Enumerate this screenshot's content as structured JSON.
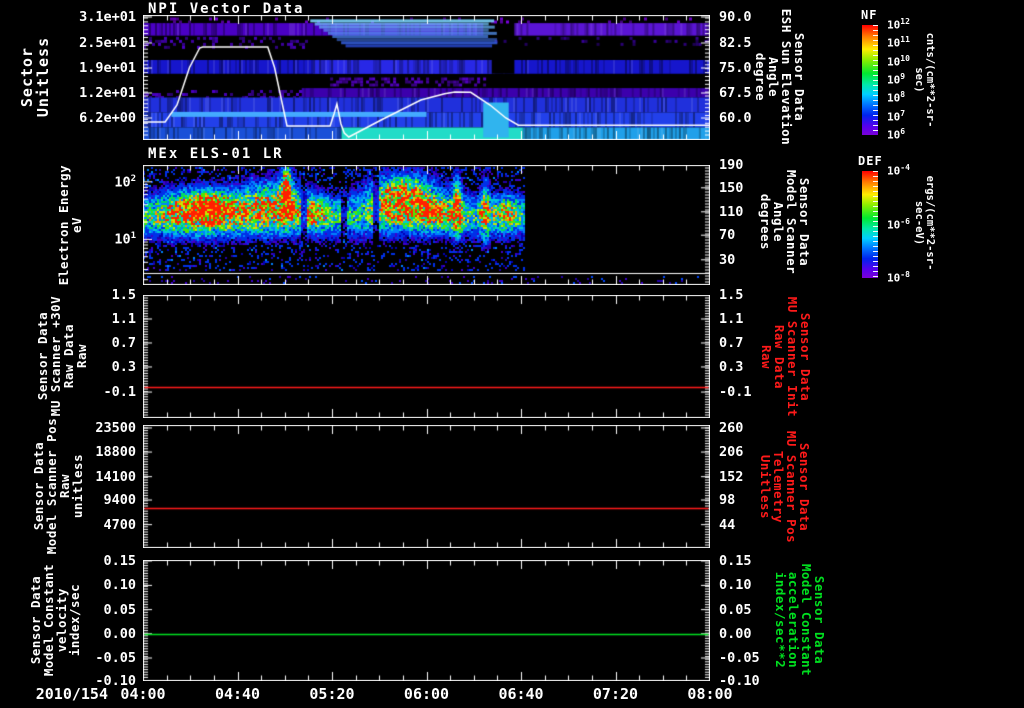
{
  "panels": [
    {
      "key": "npi",
      "title": "NPI Vector Data",
      "left_label_lines": [
        "Sector",
        "Unitless"
      ],
      "left_ticks": [
        {
          "t": "3.1e+01",
          "p": 0.016
        },
        {
          "t": "2.5e+01",
          "p": 0.224
        },
        {
          "t": "1.9e+01",
          "p": 0.424
        },
        {
          "t": "1.2e+01",
          "p": 0.624
        },
        {
          "t": "6.2e+00",
          "p": 0.824
        }
      ],
      "right_label_lines": [
        "Sensor Data",
        "ESH Sun Elevation",
        "Angle",
        "degree"
      ],
      "right_label_color": "#ffffff",
      "right_ticks": [
        {
          "t": "90.0",
          "p": 0.016
        },
        {
          "t": "82.5",
          "p": 0.224
        },
        {
          "t": "75.0",
          "p": 0.424
        },
        {
          "t": "67.5",
          "p": 0.624
        },
        {
          "t": "60.0",
          "p": 0.824
        }
      ]
    },
    {
      "key": "els",
      "title": "MEx ELS-01 LR",
      "left_label_lines": [
        "Electron Energy",
        "eV"
      ],
      "left_ticks": [
        {
          "t": "10",
          "sup": "2",
          "p": 0.14
        },
        {
          "t": "10",
          "sup": "1",
          "p": 0.62
        }
      ],
      "right_label_lines": [
        "Sensor Data",
        "Model Scanner",
        "Angle",
        "degrees"
      ],
      "right_label_color": "#ffffff",
      "right_ticks": [
        {
          "t": "190",
          "p": 0.0
        },
        {
          "t": "150",
          "p": 0.19
        },
        {
          "t": "110",
          "p": 0.39
        },
        {
          "t": "70",
          "p": 0.585
        },
        {
          "t": "30",
          "p": 0.79
        }
      ]
    },
    {
      "key": "mu-scanner-30v",
      "left_label_lines": [
        "Sensor Data",
        "MU Scanner +30V",
        "Raw Data",
        "Raw"
      ],
      "left_ticks": [
        {
          "t": "1.5",
          "p": 0.0
        },
        {
          "t": "1.1",
          "p": 0.195
        },
        {
          "t": "0.7",
          "p": 0.39
        },
        {
          "t": "0.3",
          "p": 0.585
        },
        {
          "t": "-0.1",
          "p": 0.789
        }
      ],
      "right_label_lines": [
        "Sensor Data",
        "MU Scanner Init",
        "Raw Data",
        "Raw"
      ],
      "right_label_color": "#ff1a1a",
      "right_ticks": [
        {
          "t": "1.5",
          "p": 0.0
        },
        {
          "t": "1.1",
          "p": 0.195
        },
        {
          "t": "0.7",
          "p": 0.39
        },
        {
          "t": "0.3",
          "p": 0.585
        },
        {
          "t": "-0.1",
          "p": 0.789
        }
      ],
      "hline": {
        "color": "#ff1a1a",
        "p": 0.748
      }
    },
    {
      "key": "model-scanner-pos",
      "left_label_lines": [
        "Sensor Data",
        "Model Scanner Pos",
        "Raw",
        "unitless"
      ],
      "left_ticks": [
        {
          "t": "23500",
          "p": 0.024
        },
        {
          "t": "18800",
          "p": 0.22
        },
        {
          "t": "14100",
          "p": 0.42
        },
        {
          "t": "9400",
          "p": 0.61
        },
        {
          "t": "4700",
          "p": 0.81
        }
      ],
      "right_label_lines": [
        "Sensor Data",
        "MU Scanner Pos",
        "Telemetry",
        "Unitless"
      ],
      "right_label_color": "#ff1a1a",
      "right_ticks": [
        {
          "t": "260",
          "p": 0.024
        },
        {
          "t": "206",
          "p": 0.22
        },
        {
          "t": "152",
          "p": 0.42
        },
        {
          "t": "98",
          "p": 0.61
        },
        {
          "t": "44",
          "p": 0.81
        }
      ],
      "hline": {
        "color": "#ff1a1a",
        "p": 0.675
      }
    },
    {
      "key": "model-constant",
      "left_label_lines": [
        "Sensor Data",
        "Model Constant",
        "velocity",
        "index/sec"
      ],
      "left_ticks": [
        {
          "t": "0.15",
          "p": 0.008
        },
        {
          "t": "0.10",
          "p": 0.21
        },
        {
          "t": "0.05",
          "p": 0.41
        },
        {
          "t": "0.00",
          "p": 0.61
        },
        {
          "t": "-0.05",
          "p": 0.81
        },
        {
          "t": "-0.10",
          "p": 1.0
        }
      ],
      "right_label_lines": [
        "Sensor Data",
        "Model Constant",
        "acceleration",
        "index/sec**2"
      ],
      "right_label_color": "#00e020",
      "right_ticks": [
        {
          "t": "0.15",
          "p": 0.008
        },
        {
          "t": "0.10",
          "p": 0.21
        },
        {
          "t": "0.05",
          "p": 0.41
        },
        {
          "t": "0.00",
          "p": 0.61
        },
        {
          "t": "-0.05",
          "p": 0.81
        },
        {
          "t": "-0.10",
          "p": 1.0
        }
      ],
      "hline": {
        "color": "#00e020",
        "p": 0.61
      }
    }
  ],
  "colorbars": [
    {
      "title": "NF",
      "units": "cnts/(cm**2-sr-sec)",
      "ticks": [
        {
          "t": "10",
          "sup": "12",
          "p": 0.0
        },
        {
          "t": "10",
          "sup": "11",
          "p": 0.1667
        },
        {
          "t": "10",
          "sup": "10",
          "p": 0.3333
        },
        {
          "t": "10",
          "sup": "9",
          "p": 0.5
        },
        {
          "t": "10",
          "sup": "8",
          "p": 0.6667
        },
        {
          "t": "10",
          "sup": "7",
          "p": 0.8333
        },
        {
          "t": "10",
          "sup": "6",
          "p": 1.0
        }
      ]
    },
    {
      "title": "DEF",
      "units": "ergs/(cm**2-sr-sec-eV)",
      "ticks": [
        {
          "t": "10",
          "sup": "-4",
          "p": 0.0
        },
        {
          "t": "10",
          "sup": "-6",
          "p": 0.5
        },
        {
          "t": "10",
          "sup": "-8",
          "p": 1.0
        }
      ]
    }
  ],
  "time_axis": {
    "date_label": "2010/154",
    "ticks": [
      {
        "t": "04:00",
        "p": 0.0
      },
      {
        "t": "04:40",
        "p": 0.1667
      },
      {
        "t": "05:20",
        "p": 0.3333
      },
      {
        "t": "06:00",
        "p": 0.5
      },
      {
        "t": "06:40",
        "p": 0.6667
      },
      {
        "t": "07:20",
        "p": 0.8333
      },
      {
        "t": "08:00",
        "p": 1.0
      }
    ]
  },
  "chart_data": [
    {
      "type": "heatmap",
      "panel": "npi",
      "title": "NPI Vector Data",
      "ylabel": "Sector (Unitless)",
      "y_ticks": [
        31,
        25,
        19,
        12,
        6.2
      ],
      "right_axis": {
        "label": "Sensor Data ESH Sun Elevation Angle (degree)",
        "ticks": [
          90.0,
          82.5,
          75.0,
          67.5,
          60.0
        ]
      },
      "x_range": [
        "2010/154 04:00",
        "2010/154 08:00"
      ],
      "colorbar": {
        "name": "NF",
        "units": "cnts/(cm**2-sr-sec)",
        "scale": "log",
        "min": 1000000.0,
        "max": 1000000000000.0
      },
      "bands": [
        {
          "fill": "speckle",
          "x0": 0.0,
          "x1": 1.0,
          "y0": 0.02,
          "y1": 0.055,
          "color": "#7a00e0",
          "density": 0.1
        },
        {
          "fill": "noisy",
          "x0": 0.0,
          "x1": 0.6,
          "y0": 0.065,
          "y1": 0.165,
          "color": "#4a00c4"
        },
        {
          "fill": "noisy",
          "x0": 0.655,
          "x1": 1.0,
          "y0": 0.065,
          "y1": 0.165,
          "color": "#5a14d4"
        },
        {
          "fill": "speckle",
          "x0": 0.0,
          "x1": 0.3,
          "y0": 0.175,
          "y1": 0.255,
          "color": "#4a00c4",
          "density": 0.28
        },
        {
          "fill": "speckle",
          "x0": 0.62,
          "x1": 1.0,
          "y0": 0.175,
          "y1": 0.225,
          "color": "#38009c",
          "density": 0.18
        },
        {
          "fill": "hstreaks",
          "x0": 0.295,
          "x1": 0.625,
          "y0": 0.035,
          "y1": 0.26,
          "color_top": "#7cd8ff",
          "color_bottom": "#2240e0"
        },
        {
          "fill": "noisy",
          "x0": 0.0,
          "x1": 1.0,
          "y0": 0.36,
          "y1": 0.47,
          "color": "#1616cc"
        },
        {
          "fill": "noisy",
          "x0": 0.3,
          "x1": 0.62,
          "y0": 0.36,
          "y1": 0.47,
          "color": "#2828e6"
        },
        {
          "fill": "solid",
          "x0": 0.615,
          "x1": 0.655,
          "y0": 0.36,
          "y1": 0.47,
          "color": "#000000"
        },
        {
          "fill": "speckle",
          "x0": 0.33,
          "x1": 0.6,
          "y0": 0.5,
          "y1": 0.565,
          "color": "#5800cc",
          "density": 0.5
        },
        {
          "fill": "noisy",
          "x0": 0.28,
          "x1": 1.0,
          "y0": 0.585,
          "y1": 0.66,
          "color": "#3c00ac"
        },
        {
          "fill": "speckle",
          "x0": 0.0,
          "x1": 0.28,
          "y0": 0.6,
          "y1": 0.66,
          "color": "#4a00c4",
          "density": 0.25
        },
        {
          "fill": "noisy",
          "x0": 0.0,
          "x1": 1.0,
          "y0": 0.66,
          "y1": 0.78,
          "color": "#2030dc"
        },
        {
          "fill": "noisy",
          "x0": 0.0,
          "x1": 1.0,
          "y0": 0.78,
          "y1": 0.9,
          "color": "#2240ea"
        },
        {
          "fill": "solid",
          "x0": 0.05,
          "x1": 0.5,
          "y0": 0.775,
          "y1": 0.815,
          "color": "#44aaff"
        },
        {
          "fill": "noisy",
          "x0": 0.0,
          "x1": 0.35,
          "y0": 0.9,
          "y1": 1.0,
          "color": "#1a50d8"
        },
        {
          "fill": "solid",
          "x0": 0.35,
          "x1": 0.67,
          "y0": 0.9,
          "y1": 1.0,
          "color": "#22dcc8"
        },
        {
          "fill": "noisy",
          "x0": 0.67,
          "x1": 1.0,
          "y0": 0.9,
          "y1": 1.0,
          "color": "#20a0ea"
        },
        {
          "fill": "solid",
          "x0": 0.6,
          "x1": 0.645,
          "y0": 0.7,
          "y1": 0.98,
          "color": "#30b4ee"
        }
      ],
      "overlay_line": {
        "name": "esh-sun-elevation-trace",
        "color": "#ffffff",
        "points": [
          [
            0.0,
            0.856
          ],
          [
            0.039,
            0.856
          ],
          [
            0.06,
            0.72
          ],
          [
            0.082,
            0.42
          ],
          [
            0.1,
            0.264
          ],
          [
            0.105,
            0.256
          ],
          [
            0.22,
            0.256
          ],
          [
            0.232,
            0.42
          ],
          [
            0.254,
            0.888
          ],
          [
            0.33,
            0.888
          ],
          [
            0.337,
            0.79
          ],
          [
            0.342,
            0.712
          ],
          [
            0.349,
            0.87
          ],
          [
            0.355,
            0.944
          ],
          [
            0.363,
            0.976
          ],
          [
            0.42,
            0.84
          ],
          [
            0.49,
            0.68
          ],
          [
            0.532,
            0.63
          ],
          [
            0.55,
            0.616
          ],
          [
            0.578,
            0.618
          ],
          [
            0.612,
            0.72
          ],
          [
            0.64,
            0.824
          ],
          [
            0.662,
            0.882
          ],
          [
            1.0,
            0.882
          ]
        ]
      }
    },
    {
      "type": "spectrogram",
      "panel": "els",
      "title": "MEx ELS-01 LR",
      "ylabel": "Electron Energy (eV)",
      "yscale": "log",
      "y_ticks": [
        100,
        10
      ],
      "right_axis": {
        "label": "Sensor Data Model Scanner Angle (degrees)",
        "ticks": [
          190,
          150,
          110,
          70,
          30
        ]
      },
      "colorbar": {
        "name": "DEF",
        "units": "ergs/(cm**2-sr-sec-eV)",
        "scale": "log",
        "min": 1e-08,
        "max": 0.0001
      },
      "data_end_frac": 0.672,
      "separator_line_frac": 0.9,
      "band": {
        "y_center": 0.47,
        "y_sigma": 0.13,
        "amp": 0.52
      },
      "blobs": [
        {
          "cx": 0.105,
          "cy": 0.4,
          "rx": 0.05,
          "ry": 0.14,
          "amp": 0.62
        },
        {
          "cx": 0.118,
          "cy": 0.36,
          "rx": 0.016,
          "ry": 0.06,
          "amp": 0.55
        },
        {
          "cx": 0.23,
          "cy": 0.33,
          "rx": 0.04,
          "ry": 0.15,
          "amp": 0.55
        },
        {
          "cx": 0.252,
          "cy": 0.2,
          "rx": 0.006,
          "ry": 0.16,
          "amp": 0.9
        },
        {
          "cx": 0.3,
          "cy": 0.43,
          "rx": 0.02,
          "ry": 0.09,
          "amp": 0.35
        },
        {
          "cx": 0.458,
          "cy": 0.27,
          "rx": 0.04,
          "ry": 0.14,
          "amp": 0.85
        },
        {
          "cx": 0.52,
          "cy": 0.44,
          "rx": 0.028,
          "ry": 0.08,
          "amp": 0.4
        },
        {
          "cx": 0.552,
          "cy": 0.35,
          "rx": 0.006,
          "ry": 0.22,
          "amp": 0.55
        },
        {
          "cx": 0.602,
          "cy": 0.4,
          "rx": 0.006,
          "ry": 0.2,
          "amp": 0.5
        },
        {
          "cx": 0.638,
          "cy": 0.42,
          "rx": 0.014,
          "ry": 0.1,
          "amp": 0.42
        }
      ],
      "dark_columns": [
        0.282,
        0.352,
        0.408
      ]
    },
    {
      "type": "line",
      "panel": "mu-scanner-30v",
      "series": [
        {
          "name": "Sensor Data MU Scanner +30V Raw Data Raw",
          "color": "#ff1a1a",
          "constant_value": 0.0
        }
      ],
      "y_ticks": [
        1.5,
        1.1,
        0.7,
        0.3,
        -0.1
      ]
    },
    {
      "type": "line",
      "panel": "model-scanner-pos",
      "series": [
        {
          "name": "Sensor Data Model Scanner Pos Raw unitless",
          "color": "#ff1a1a",
          "constant_value": 7900
        }
      ],
      "y_ticks": [
        23500,
        18800,
        14100,
        9400,
        4700
      ],
      "right_y_ticks": [
        260,
        206,
        152,
        98,
        44
      ]
    },
    {
      "type": "line",
      "panel": "model-constant",
      "series": [
        {
          "name": "Sensor Data Model Constant velocity index/sec",
          "color": "#00e020",
          "constant_value": 0.0
        }
      ],
      "y_ticks": [
        0.15,
        0.1,
        0.05,
        0.0,
        -0.05,
        -0.1
      ]
    }
  ]
}
